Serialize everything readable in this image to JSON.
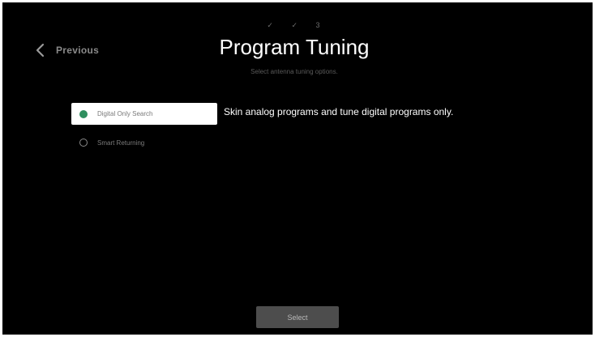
{
  "wizard": {
    "steps": [
      "✓",
      "✓",
      "3"
    ]
  },
  "nav": {
    "back_label": "Previous"
  },
  "header": {
    "title": "Program Tuning",
    "subtitle": "Select antenna tuning options."
  },
  "options": [
    {
      "label": "Digital Only Search",
      "selected": true
    },
    {
      "label": "Smart Returning",
      "selected": false
    }
  ],
  "details": {
    "description": "Skin analog programs and tune digital programs only."
  },
  "footer": {
    "next_label": "Select"
  },
  "colors": {
    "background": "#000000",
    "selected_radio": "#2f8f5f",
    "button": "#4d4d4d"
  }
}
